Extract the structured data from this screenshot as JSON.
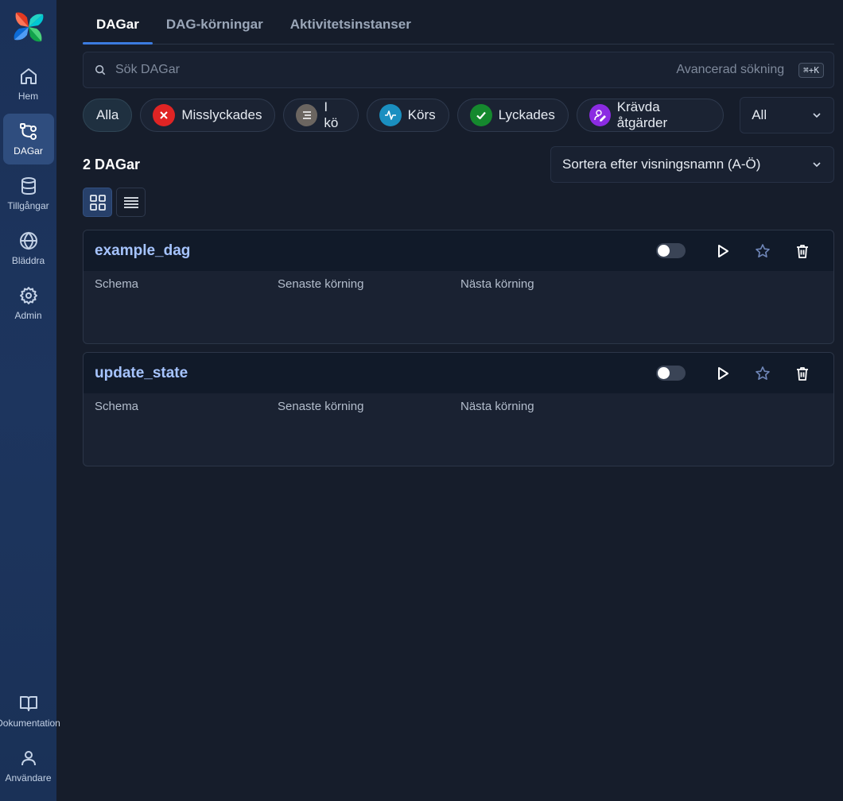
{
  "sidebar": {
    "logo": "airflow-pinwheel-logo",
    "items": [
      {
        "label": "Hem",
        "icon": "home-icon"
      },
      {
        "label": "DAGar",
        "icon": "dag-icon",
        "active": true
      },
      {
        "label": "Tillgångar",
        "icon": "database-icon"
      },
      {
        "label": "Bläddra",
        "icon": "globe-icon"
      },
      {
        "label": "Admin",
        "icon": "gear-icon"
      }
    ],
    "bottom_items": [
      {
        "label": "Dokumentation",
        "icon": "book-icon"
      },
      {
        "label": "Användare",
        "icon": "user-icon"
      }
    ]
  },
  "tabs": [
    {
      "label": "DAGar",
      "active": true
    },
    {
      "label": "DAG-körningar"
    },
    {
      "label": "Aktivitetsinstanser"
    }
  ],
  "search": {
    "placeholder": "Sök DAGar",
    "value": "",
    "advanced_label": "Avancerad sökning",
    "shortcut": "⌘+K"
  },
  "filters": {
    "chips": [
      {
        "label": "Alla",
        "active": true
      },
      {
        "label": "Misslyckades",
        "color": "#e02424",
        "icon": "x-icon"
      },
      {
        "label": "I kö",
        "color": "#6b6560",
        "icon": "queue-icon"
      },
      {
        "label": "Körs",
        "color": "#1a8fc0",
        "icon": "activity-icon"
      },
      {
        "label": "Lyckades",
        "color": "#15892e",
        "icon": "check-icon"
      },
      {
        "label": "Krävda åtgärder",
        "color": "#8b2be2",
        "icon": "user-edit-icon"
      }
    ],
    "select_value": "All"
  },
  "dag_count": "2 DAGar",
  "sort": {
    "value": "Sortera efter visningsnamn (A-Ö)"
  },
  "view_modes": {
    "active": "card"
  },
  "dags": [
    {
      "name": "example_dag",
      "paused": true,
      "columns": [
        "Schema",
        "Senaste körning",
        "Nästa körning"
      ]
    },
    {
      "name": "update_state",
      "paused": true,
      "columns": [
        "Schema",
        "Senaste körning",
        "Nästa körning"
      ]
    }
  ],
  "colors": {
    "accent": "#3b7be0",
    "dag_link": "#a6c4ff",
    "sidebar_bg": "#1b3158",
    "page_bg": "#161d2b"
  }
}
